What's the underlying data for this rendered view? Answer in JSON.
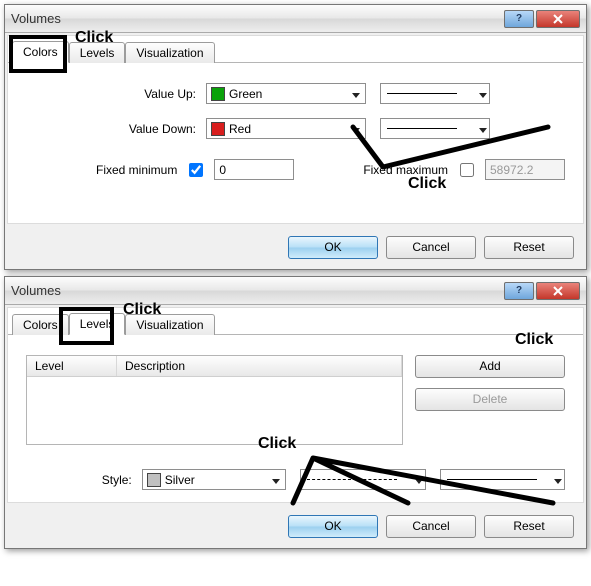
{
  "dialog1": {
    "title": "Volumes",
    "tabs": {
      "colors": "Colors",
      "levels": "Levels",
      "visualization": "Visualization"
    },
    "value_up_label": "Value Up:",
    "value_up_color": "Green",
    "value_up_hex": "#0aa20a",
    "value_down_label": "Value Down:",
    "value_down_color": "Red",
    "value_down_hex": "#d81e1e",
    "fixed_min_label": "Fixed minimum",
    "fixed_min_value": "0",
    "fixed_max_label": "Fixed maximum",
    "fixed_max_value": "58972.2",
    "buttons": {
      "ok": "OK",
      "cancel": "Cancel",
      "reset": "Reset"
    },
    "anno_tab": "Click",
    "anno_line": "Click"
  },
  "dialog2": {
    "title": "Volumes",
    "tabs": {
      "colors": "Colors",
      "levels": "Levels",
      "visualization": "Visualization"
    },
    "table": {
      "level_header": "Level",
      "desc_header": "Description"
    },
    "add_label": "Add",
    "delete_label": "Delete",
    "style_label": "Style:",
    "style_color": "Silver",
    "style_hex": "#c0c0c0",
    "buttons": {
      "ok": "OK",
      "cancel": "Cancel",
      "reset": "Reset"
    },
    "anno_tab": "Click",
    "anno_add": "Click",
    "anno_style": "Click"
  }
}
